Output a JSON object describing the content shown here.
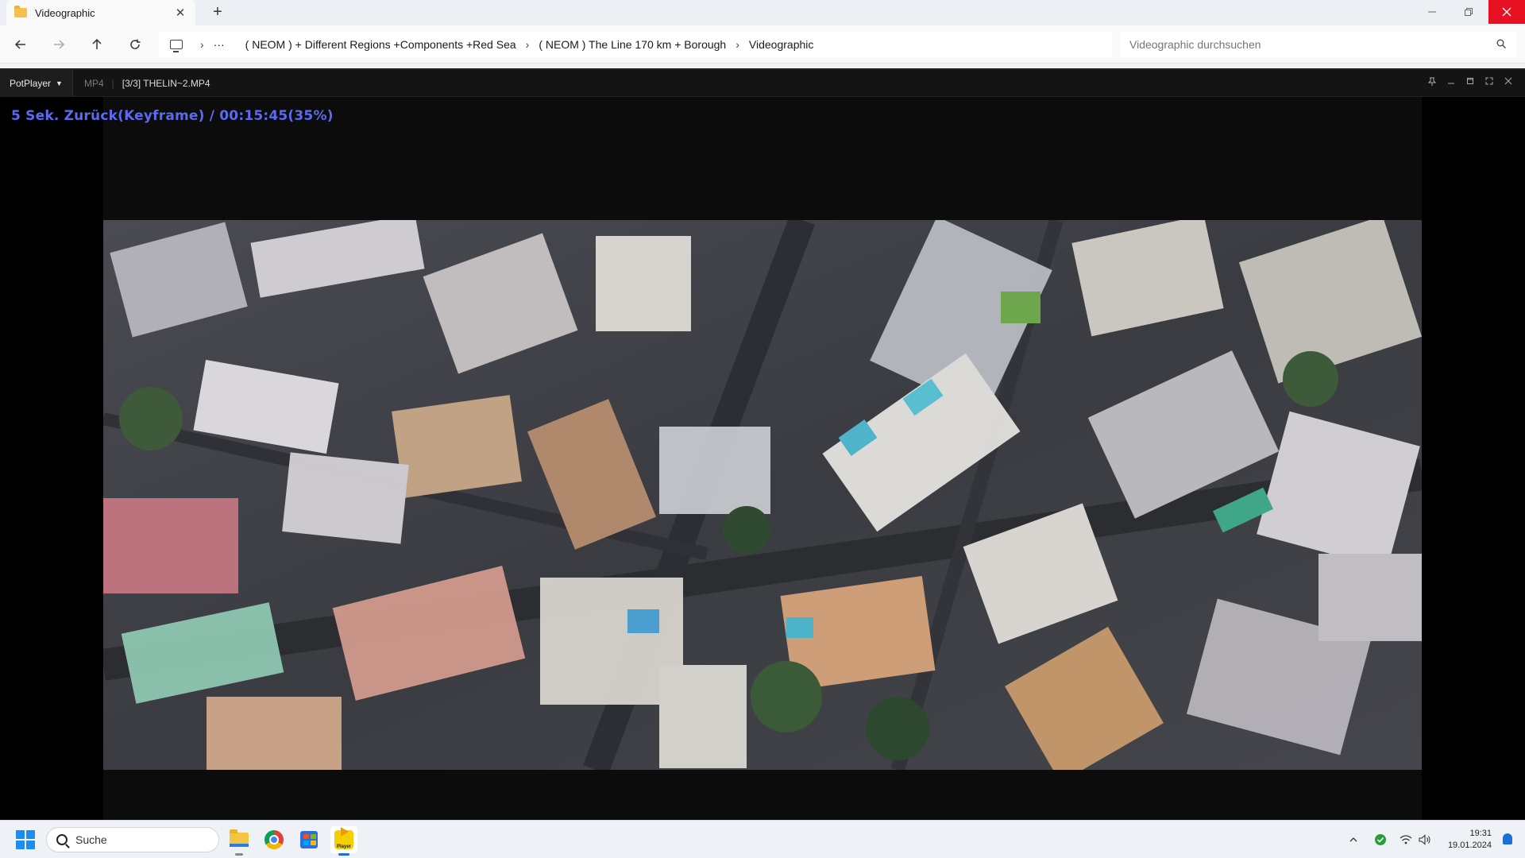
{
  "explorer": {
    "tab_title": "Videographic",
    "tab_close": "✕",
    "new_tab": "+",
    "breadcrumb": [
      "( NEOM ) + Different Regions +Components +Red Sea",
      "( NEOM ) The Line 170 km + Borough",
      "Videographic"
    ],
    "more": "···",
    "search_placeholder": "Videographic durchsuchen"
  },
  "player": {
    "brand": "PotPlayer",
    "format": "MP4",
    "filename": "[3/3] THELIN~2.MP4",
    "osd": "5  Sek. Zurück(Keyframe) / 00:15:45(35%)",
    "progress_percent": 35
  },
  "taskbar": {
    "search_label": "Suche",
    "pot_label": "Player",
    "time": "19:31",
    "date": "19.01.2024"
  },
  "colors": {
    "osd_text": "#5b6af0",
    "close_button": "#e81123",
    "start_blue": "#1c8cf0"
  },
  "icons": {
    "back": "arrow-left-icon",
    "forward": "arrow-right-icon",
    "up": "arrow-up-icon",
    "refresh": "refresh-icon",
    "search": "search-icon"
  }
}
